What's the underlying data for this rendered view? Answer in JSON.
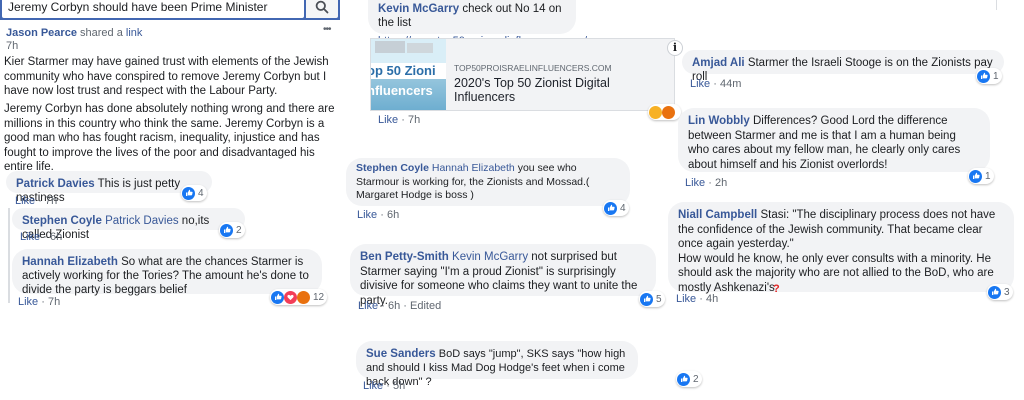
{
  "search": {
    "value": "Jeremy Corbyn should have been Prime Minister"
  },
  "post": {
    "author": "Jason Pearce",
    "action": "shared a",
    "link_word": "link",
    "time": "7h",
    "more": "•••",
    "paragraph1": "Kier Starmer may have gained trust with elements of the Jewish community who have conspired to remove Jeremy Corbyn but I have now lost trust and respect with the Labour Party.",
    "paragraph2": "Jeremy Corbyn has done absolutely nothing wrong and there are millions in this country who think the same. Jeremy Corbyn is a good man who has fought racism, inequality, injustice and has fought to improve the lives of the poor and disadvantaged his entire life."
  },
  "comments_left": [
    {
      "author": "Patrick Davies",
      "tag": "",
      "text": "This is just petty nastiness",
      "like": "Like",
      "time": "7h",
      "count": "4"
    },
    {
      "author": "Stephen Coyle",
      "tag": "Patrick Davies",
      "text": "no,its called Zionist",
      "like": "Like",
      "time": "6h",
      "count": "2"
    },
    {
      "author": "Hannah Elizabeth",
      "tag": "",
      "text": "So what are the chances Starmer is actively working for the Tories? The amount he's done to divide the party is beggars belief",
      "like": "Like",
      "time": "7h",
      "count": "12"
    }
  ],
  "middle": {
    "top_comment": {
      "author": "Kevin McGarry",
      "text": "check out No 14 on the list",
      "url": "https://www.top50proisraelinfluencers.com/"
    },
    "preview": {
      "image_text_1": "op 50 Zioni",
      "image_text_2": "nfluencers",
      "domain": "TOP50PROISRAELINFLUENCERS.COM",
      "title": "2020's Top 50 Zionist Digital Influencers",
      "info_icon": "i"
    },
    "preview_like": "Like",
    "preview_time": "7h",
    "comments": [
      {
        "author": "Stephen Coyle",
        "tag": "Hannah Elizabeth",
        "text": "you see who Starmour is working for, the Zionists and Mossad.( Margaret Hodge is boss )",
        "like": "Like",
        "time": "6h",
        "count": "4"
      },
      {
        "author": "Ben Petty-Smith",
        "tag": "Kevin McGarry",
        "text": "not surprised but Starmer saying \"I'm a proud Zionist\" is surprisingly divisive for someone who claims they want to unite the party.",
        "like": "Like",
        "time": "6h",
        "edited": "Edited",
        "count": "5"
      },
      {
        "author": "Sue Sanders",
        "tag": "",
        "text": "BoD says \"jump\", SKS says \"how high and should I kiss Mad Dog Hodge's feet when i come back down\" ?",
        "like": "Like",
        "time": "5h",
        "count": "2"
      }
    ]
  },
  "comments_right": [
    {
      "author": "Amjad Ali",
      "text": "Starmer the Israeli Stooge is on the Zionists pay roll",
      "like": "Like",
      "time": "44m",
      "count": "1"
    },
    {
      "author": "Lin Wobbly",
      "text": "Differences? Good Lord the difference between Starmer and me is that I am a human being who cares about my fellow man, he clearly only cares about himself and his Zionist overlords!",
      "like": "Like",
      "time": "2h",
      "count": "1"
    },
    {
      "author": "Niall Campbell",
      "text": "Stasi: \"The disciplinary process does not have the confidence of the Jewish community. That became clear once again yesterday.\"",
      "text2": "How would he know, he only ever consults with a minority. He should ask the majority who are not allied to the BoD, who are mostly Ashkenazi's",
      "like": "Like",
      "time": "4h",
      "count": "3",
      "mark": "?"
    }
  ],
  "colors": {
    "link": "#385898",
    "bubble": "#f2f3f5",
    "like_blue": "#1877f2"
  }
}
